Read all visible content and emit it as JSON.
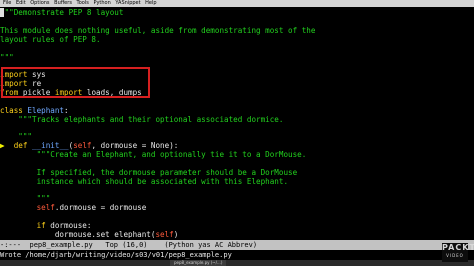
{
  "menubar": {
    "items": [
      "File",
      "Edit",
      "Options",
      "Buffers",
      "Tools",
      "Python",
      "YASnippet",
      "Help"
    ]
  },
  "code": {
    "l1": "\"\"\"Demonstrate PEP 8 layout",
    "l2": "This module does nothing useful, aside from demonstrating most of the",
    "l3": "layout rules of PEP 8.",
    "l4": "\"\"\"",
    "l5_kw": "import",
    "l5_rest": " sys",
    "l6_kw": "import",
    "l6_rest": " re",
    "l7_kw1": "from",
    "l7_mid": " pickle ",
    "l7_kw2": "import",
    "l7_rest": " loads, dumps",
    "l8_kw": "class",
    "l8_name": " Elephant",
    "l8_rest": ":",
    "l9": "    \"\"\"Tracks elephants and their optional associated dormice.",
    "l10": "    \"\"\"",
    "l11_kw": "def",
    "l11_name": " __init__",
    "l11_p1": "(",
    "l11_self": "self",
    "l11_rest": ", dormouse = None):",
    "l12": "        \"\"\"Create an Elephant, and optionally tie it to a DorMouse.",
    "l13": "        If specified, the dormouse parameter should be a DorMouse",
    "l14": "        instance which should be associated with this Elephant.",
    "l15": "        \"\"\"",
    "l16_self": "        self",
    "l16_rest": ".dormouse = dormouse",
    "l17_kw": "        if",
    "l17_rest": " dormouse:",
    "l18_pre": "            dormouse.set_elephant(",
    "l18_self": "self",
    "l18_rest": ")",
    "breakpoint_glyph": "▶"
  },
  "modeline": {
    "text": "-:---  pep8_example.py   Top (16,0)    (Python yas AC Abbrev)"
  },
  "minibuffer": {
    "text": "Wrote /home/djarb/writing/video/s03/v01/pep8_example.py"
  },
  "taskbar": {
    "label": "pep8_example.py (~/...)"
  },
  "logo": {
    "name": "PACKT",
    "sub": "VIDEO"
  },
  "colors": {
    "string": "#22d11e",
    "keyword": "#ffd21a",
    "function": "#6fa8ff",
    "self": "#ff5a3c",
    "highlight": "#d62020"
  }
}
